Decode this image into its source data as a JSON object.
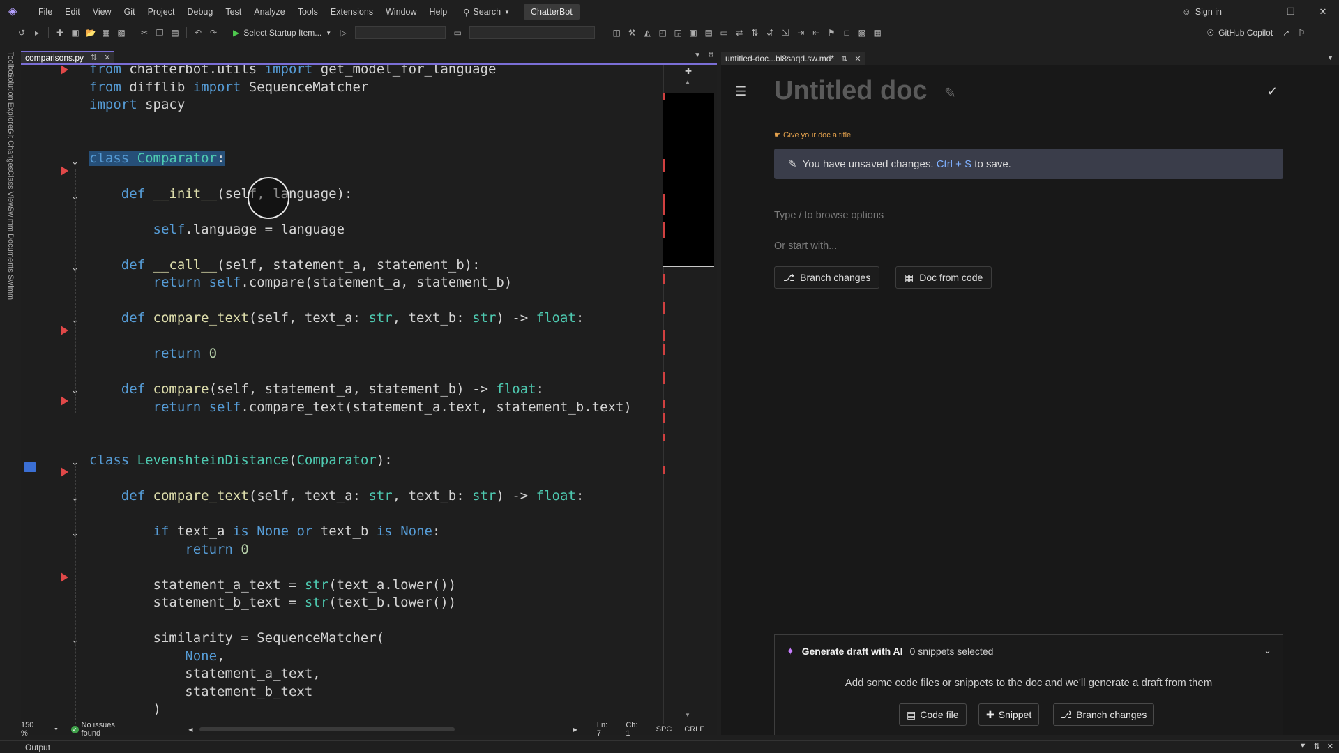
{
  "menu": [
    "File",
    "Edit",
    "View",
    "Git",
    "Project",
    "Debug",
    "Test",
    "Analyze",
    "Tools",
    "Extensions",
    "Window",
    "Help"
  ],
  "search_label": "Search",
  "solution_name": "ChatterBot",
  "sign_in": "Sign in",
  "toolbar": {
    "startup_item": "Select Startup Item...",
    "copilot": "GitHub Copilot"
  },
  "side_rail": [
    "Toolbox",
    "Solution Explorer",
    "Git Changes",
    "Class View",
    "Swimm Documents",
    "Swimm"
  ],
  "editor_tab": {
    "filename": "comparisons.py"
  },
  "doc_tab": {
    "filename": "untitled-doc...bl8saqd.sw.md*"
  },
  "code_lines": [
    [
      {
        "t": "from ",
        "c": "kw"
      },
      {
        "t": "chatterbot.utils "
      },
      {
        "t": "import ",
        "c": "kw"
      },
      {
        "t": "get_model_for_language"
      }
    ],
    [
      {
        "t": "from ",
        "c": "kw"
      },
      {
        "t": "difflib "
      },
      {
        "t": "import ",
        "c": "kw"
      },
      {
        "t": "SequenceMatcher"
      }
    ],
    [
      {
        "t": "import ",
        "c": "kw"
      },
      {
        "t": "spacy"
      }
    ],
    [],
    [],
    [
      {
        "t": "class ",
        "c": "kw sel"
      },
      {
        "t": "Comparator",
        "c": "cls sel"
      },
      {
        "t": ":",
        "c": "sel"
      }
    ],
    [],
    [
      {
        "t": "    def ",
        "c": "kw"
      },
      {
        "t": "__init__",
        "c": "fn"
      },
      {
        "t": "(self, language):"
      }
    ],
    [],
    [
      {
        "t": "        self",
        "c": "kw"
      },
      {
        "t": ".language = language"
      }
    ],
    [],
    [
      {
        "t": "    def ",
        "c": "kw"
      },
      {
        "t": "__call__",
        "c": "fn"
      },
      {
        "t": "(self, statement_a, statement_b):"
      }
    ],
    [
      {
        "t": "        return ",
        "c": "kw"
      },
      {
        "t": "self",
        "c": "kw"
      },
      {
        "t": ".compare(statement_a, statement_b)"
      }
    ],
    [],
    [
      {
        "t": "    def ",
        "c": "kw"
      },
      {
        "t": "compare_text",
        "c": "fn"
      },
      {
        "t": "(self, text_a: "
      },
      {
        "t": "str",
        "c": "cls"
      },
      {
        "t": ", text_b: "
      },
      {
        "t": "str",
        "c": "cls"
      },
      {
        "t": ") -> "
      },
      {
        "t": "float",
        "c": "cls"
      },
      {
        "t": ":"
      }
    ],
    [],
    [
      {
        "t": "        return ",
        "c": "kw"
      },
      {
        "t": "0",
        "c": "num"
      }
    ],
    [],
    [
      {
        "t": "    def ",
        "c": "kw"
      },
      {
        "t": "compare",
        "c": "fn"
      },
      {
        "t": "(self, statement_a, statement_b) -> "
      },
      {
        "t": "float",
        "c": "cls"
      },
      {
        "t": ":"
      }
    ],
    [
      {
        "t": "        return ",
        "c": "kw"
      },
      {
        "t": "self",
        "c": "kw"
      },
      {
        "t": ".compare_text(statement_a.text, statement_b.text)"
      }
    ],
    [],
    [],
    [
      {
        "t": "class ",
        "c": "kw"
      },
      {
        "t": "LevenshteinDistance",
        "c": "cls"
      },
      {
        "t": "("
      },
      {
        "t": "Comparator",
        "c": "cls"
      },
      {
        "t": "):"
      }
    ],
    [],
    [
      {
        "t": "    def ",
        "c": "kw"
      },
      {
        "t": "compare_text",
        "c": "fn"
      },
      {
        "t": "(self, text_a: "
      },
      {
        "t": "str",
        "c": "cls"
      },
      {
        "t": ", text_b: "
      },
      {
        "t": "str",
        "c": "cls"
      },
      {
        "t": ") -> "
      },
      {
        "t": "float",
        "c": "cls"
      },
      {
        "t": ":"
      }
    ],
    [],
    [
      {
        "t": "        if ",
        "c": "kw"
      },
      {
        "t": "text_a "
      },
      {
        "t": "is ",
        "c": "kw"
      },
      {
        "t": "None ",
        "c": "kw"
      },
      {
        "t": "or ",
        "c": "kw"
      },
      {
        "t": "text_b "
      },
      {
        "t": "is ",
        "c": "kw"
      },
      {
        "t": "None",
        "c": "kw"
      },
      {
        "t": ":"
      }
    ],
    [
      {
        "t": "            return ",
        "c": "kw"
      },
      {
        "t": "0",
        "c": "num"
      }
    ],
    [],
    [
      {
        "t": "        statement_a_text = "
      },
      {
        "t": "str",
        "c": "cls"
      },
      {
        "t": "(text_a.lower())"
      }
    ],
    [
      {
        "t": "        statement_b_text = "
      },
      {
        "t": "str",
        "c": "cls"
      },
      {
        "t": "(text_b.lower())"
      }
    ],
    [],
    [
      {
        "t": "        similarity = SequenceMatcher("
      }
    ],
    [
      {
        "t": "            None",
        "c": "kw"
      },
      {
        "t": ","
      }
    ],
    [
      {
        "t": "            statement_a_text,"
      }
    ],
    [
      {
        "t": "            statement_b_text"
      }
    ],
    [
      {
        "t": "        )"
      }
    ]
  ],
  "editor_status": {
    "zoom": "150 %",
    "issues": "No issues found",
    "line": "Ln: 7",
    "col": "Ch: 1",
    "whitespace": "SPC",
    "eol": "CRLF"
  },
  "doc": {
    "title": "Untitled doc",
    "hint": "Give your doc a title",
    "unsaved_prefix": "You have unsaved changes.",
    "unsaved_shortcut": "Ctrl + S",
    "unsaved_suffix": "to save.",
    "type_placeholder": "Type / to browse options",
    "or_start": "Or start with...",
    "branch_changes": "Branch changes",
    "doc_from_code": "Doc from code"
  },
  "ai": {
    "title": "Generate draft with AI",
    "count": "0 snippets selected",
    "text": "Add some code files or snippets to the doc and we'll generate a draft from them",
    "code_file": "Code file",
    "snippet": "Snippet",
    "branch_changes": "Branch changes"
  },
  "output_label": "Output"
}
